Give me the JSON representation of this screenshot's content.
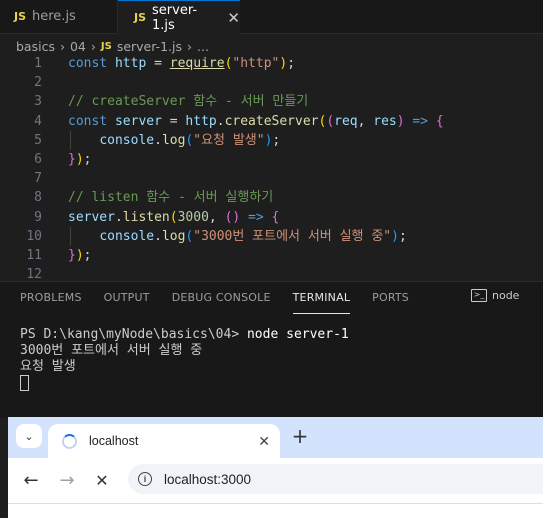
{
  "editor": {
    "tabs": [
      {
        "icon": "JS",
        "label": "here.js"
      },
      {
        "icon": "JS",
        "label": "server-1.js",
        "close": "✕"
      }
    ],
    "breadcrumb": [
      "basics",
      "04",
      "server-1.js",
      "..."
    ],
    "breadcrumb_icon": "JS",
    "lines": [
      {
        "n": "1"
      },
      {
        "n": "2"
      },
      {
        "n": "3"
      },
      {
        "n": "4"
      },
      {
        "n": "5"
      },
      {
        "n": "6"
      },
      {
        "n": "7"
      },
      {
        "n": "8"
      },
      {
        "n": "9"
      },
      {
        "n": "10"
      },
      {
        "n": "11"
      },
      {
        "n": "12"
      }
    ],
    "code": {
      "l1": {
        "kw": "const",
        "v": "http",
        "eq": " = ",
        "fn": "require",
        "s": "\"http\"",
        "end": ";"
      },
      "l3": "// createServer 함수 - 서버 만들기",
      "l4": {
        "kw": "const",
        "v": "server",
        "eq": " = ",
        "obj": "http",
        "fn": "createServer",
        "p1": "req",
        "p2": "res",
        "arrow": " => "
      },
      "l5": {
        "obj": "console",
        "fn": "log",
        "s": "\"요청 발생\""
      },
      "l6": "});",
      "l8": "// listen 함수 - 서버 실행하기",
      "l9": {
        "v": "server",
        "fn": "listen",
        "num": "3000",
        "arrow": " => "
      },
      "l10": {
        "obj": "console",
        "fn": "log",
        "s": "\"3000번 포트에서 서버 실행 중\""
      },
      "l11": "});"
    }
  },
  "panel": {
    "tabs": [
      "PROBLEMS",
      "OUTPUT",
      "DEBUG CONSOLE",
      "TERMINAL",
      "PORTS"
    ],
    "active_tab": "TERMINAL",
    "shell_label": "node",
    "terminal": {
      "prompt": "PS D:\\kang\\myNode\\basics\\04> ",
      "command": "node server-1",
      "output": [
        "3000번 포트에서 서버 실행 중",
        "요청 발생"
      ]
    }
  },
  "browser": {
    "tab_title": "localhost",
    "new_tab": "+",
    "address": "localhost:3000"
  },
  "colors": {
    "editor_bg": "#1e1e1e",
    "keyword": "#569cd6",
    "string": "#ce9178",
    "comment": "#6a9955",
    "browser_tabstrip": "#d3e3fd"
  }
}
